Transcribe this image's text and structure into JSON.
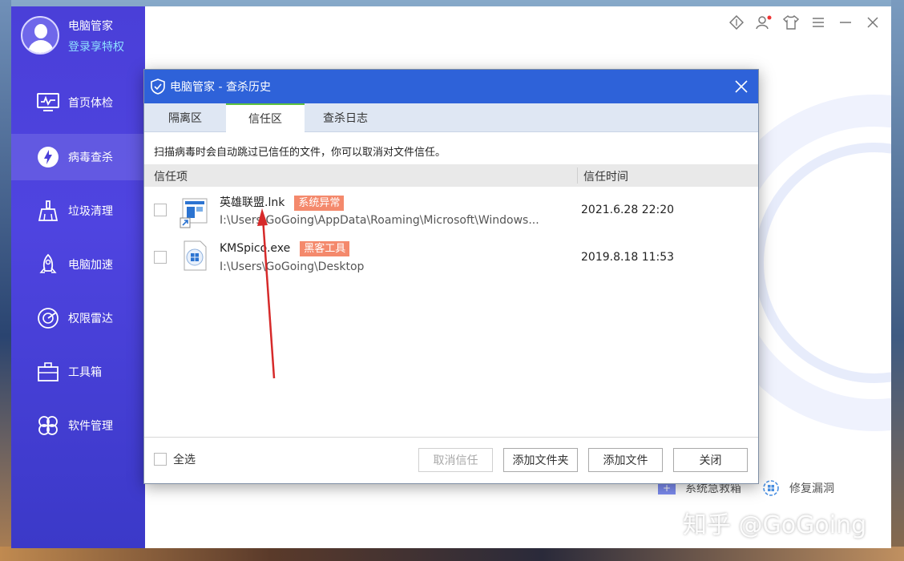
{
  "sidebar": {
    "app_name": "电脑管家",
    "login_text": "登录享特权",
    "items": [
      {
        "label": "首页体检"
      },
      {
        "label": "病毒查杀"
      },
      {
        "label": "垃圾清理"
      },
      {
        "label": "电脑加速"
      },
      {
        "label": "权限雷达"
      },
      {
        "label": "工具箱"
      },
      {
        "label": "软件管理"
      }
    ]
  },
  "main": {
    "tools": [
      {
        "label": "系统急救箱"
      },
      {
        "label": "修复漏洞"
      }
    ],
    "watermark": "知乎 @GoGoing"
  },
  "dialog": {
    "title": "电脑管家 - 查杀历史",
    "tabs": [
      {
        "label": "隔离区"
      },
      {
        "label": "信任区"
      },
      {
        "label": "查杀日志"
      }
    ],
    "hint": "扫描病毒时会自动跳过已信任的文件，你可以取消对文件信任。",
    "columns": {
      "item": "信任项",
      "time": "信任时间"
    },
    "rows": [
      {
        "name": "英雄联盟.lnk",
        "tag": "系统异常",
        "path": "I:\\Users\\GoGoing\\AppData\\Roaming\\Microsoft\\Windows...",
        "time": "2021.6.28 22:20"
      },
      {
        "name": "KMSpico.exe",
        "tag": "黑客工具",
        "path": "I:\\Users\\GoGoing\\Desktop",
        "time": "2019.8.18 11:53"
      }
    ],
    "select_all": "全选",
    "buttons": {
      "untrust": "取消信任",
      "add_folder": "添加文件夹",
      "add_file": "添加文件",
      "close": "关闭"
    }
  },
  "colors": {
    "sidebar": "#4a3fd8",
    "titlebar": "#2e62d9",
    "tag": "#f4896c",
    "active_tab_accent": "#5fc23d",
    "annotation_arrow": "#d62a2a"
  }
}
